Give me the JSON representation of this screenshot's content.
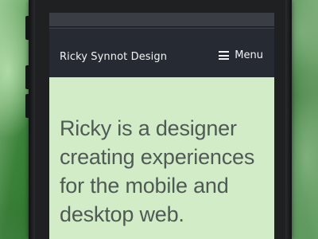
{
  "site": {
    "title": "Ricky Synnot Design",
    "menu_label": "Menu"
  },
  "hero": {
    "line1": "Ricky is a designer",
    "line2": "creating experiences",
    "line3": "for the mobile and",
    "line4": "desktop web."
  },
  "colors": {
    "navbar": "#252a33",
    "hero_background": "#d3ecc8",
    "hero_text": "#4f5a54",
    "nav_text": "#f2f4f7"
  },
  "icons": {
    "menu": "hamburger-icon"
  }
}
